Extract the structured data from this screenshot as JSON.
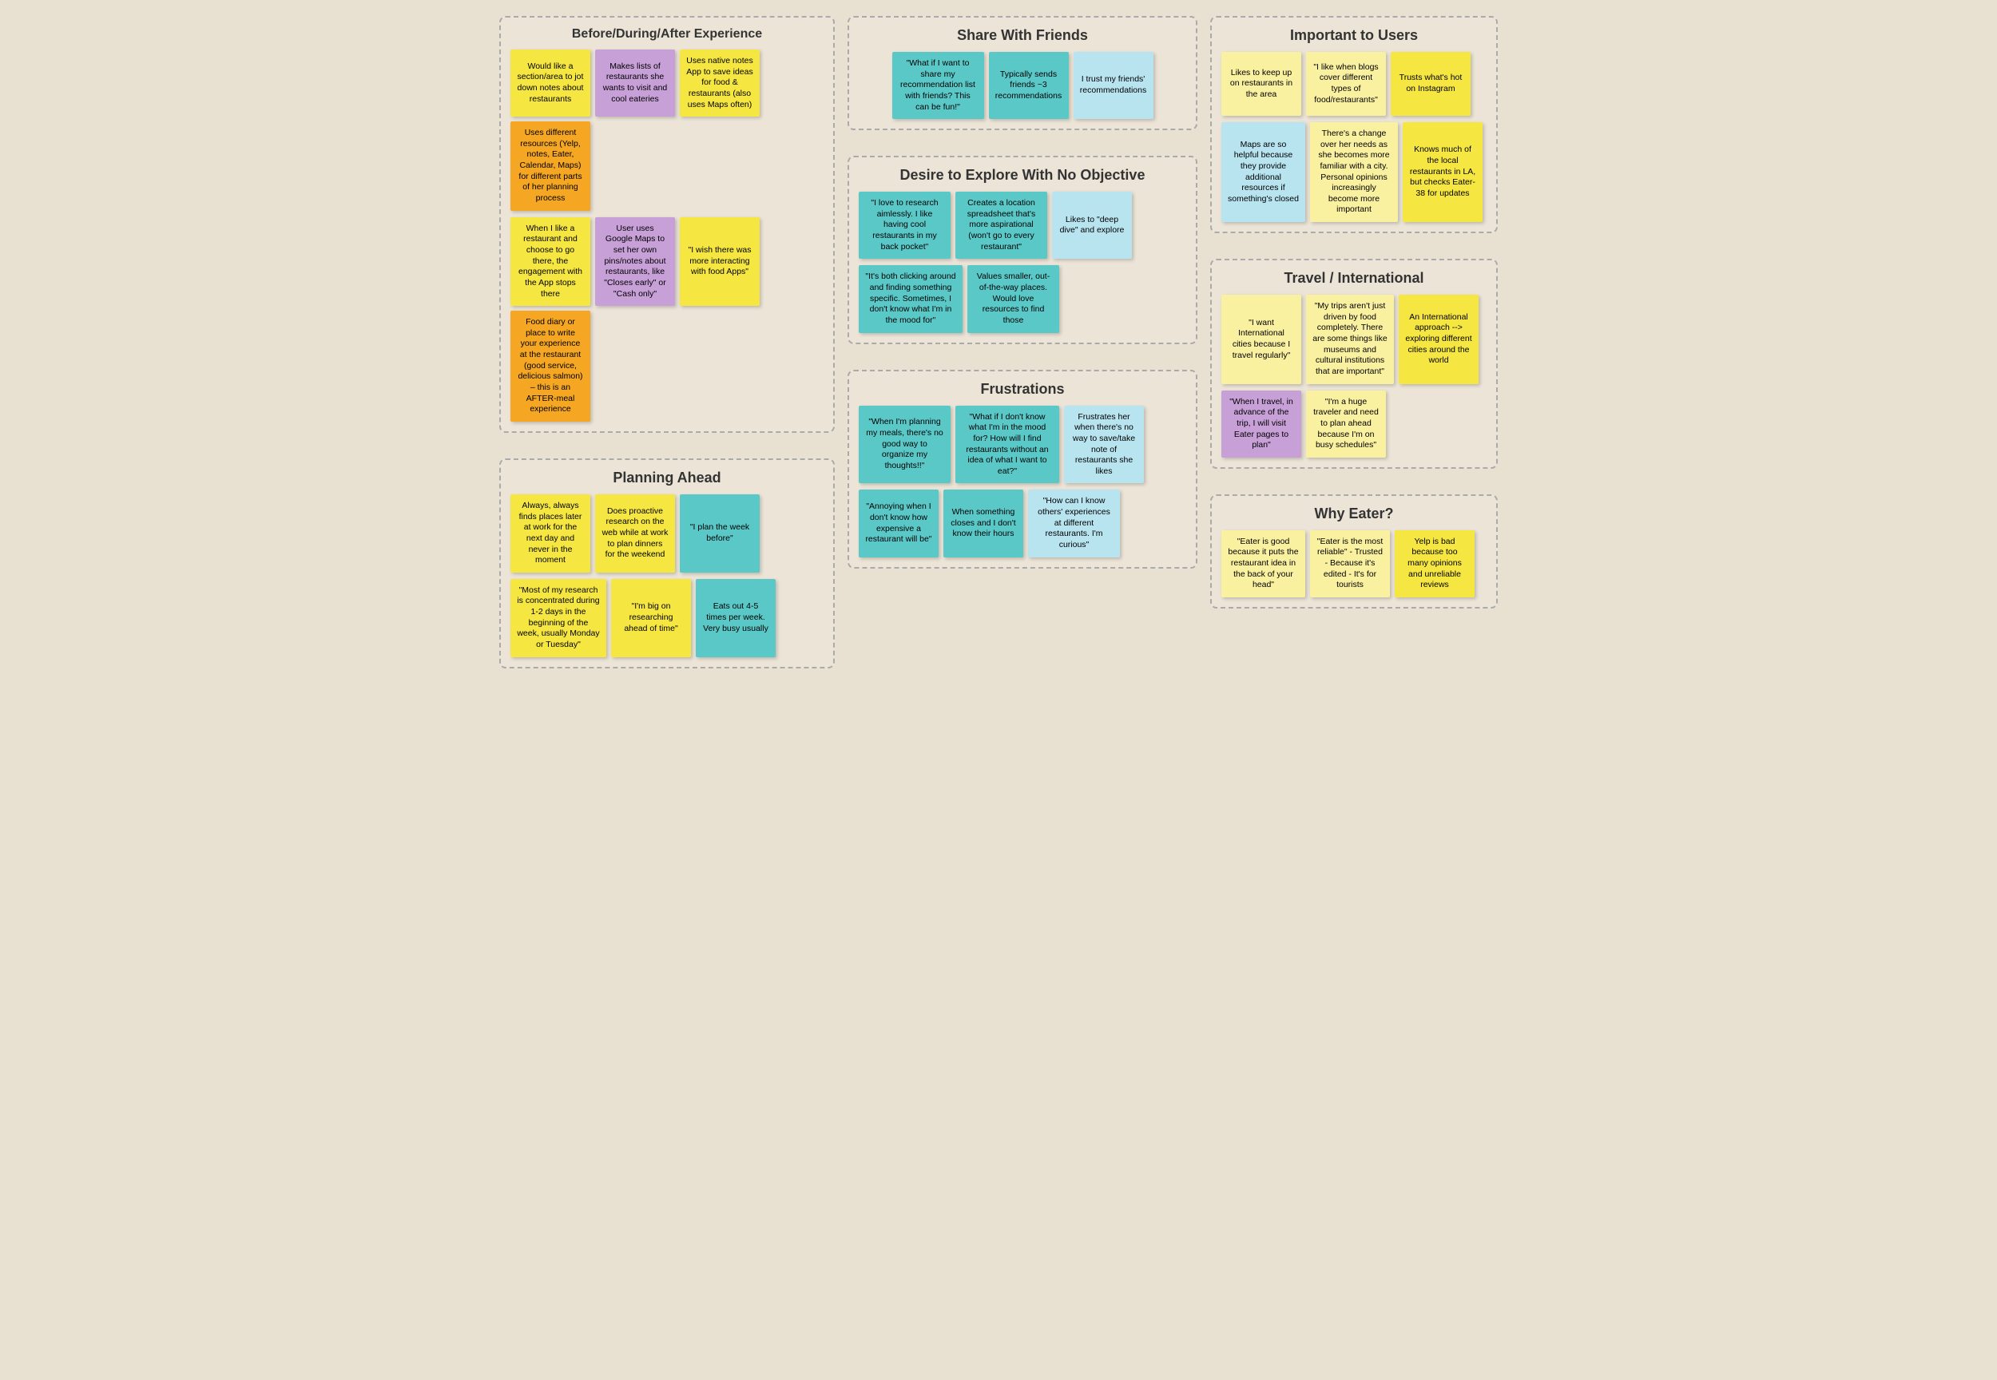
{
  "sections": {
    "before_during_after": {
      "title": "Before/During/After Experience",
      "stickies_row1": [
        {
          "text": "Would like a section/area to jot down notes about restaurants",
          "color": "yellow"
        },
        {
          "text": "Makes lists of restaurants she wants to visit and cool eateries",
          "color": "purple"
        },
        {
          "text": "Uses native notes App to save ideas for food & restaurants (also uses Maps often)",
          "color": "yellow"
        },
        {
          "text": "Uses different resources (Yelp, notes, Eater, Calendar, Maps) for different parts of her planning process",
          "color": "orange"
        }
      ],
      "stickies_row2": [
        {
          "text": "When I like a restaurant and choose to go there, the engagement with the App stops there",
          "color": "yellow"
        },
        {
          "text": "User uses Google Maps to set her own pins/notes about restaurants, like \"Closes early\" or \"Cash only\"",
          "color": "purple"
        },
        {
          "text": "\"I wish there was more interacting with food Apps\"",
          "color": "yellow"
        },
        {
          "text": "Food diary or place to write your experience at the restaurant (good service, delicious salmon) – this is an AFTER-meal experience",
          "color": "orange"
        }
      ]
    },
    "planning_ahead": {
      "title": "Planning Ahead",
      "stickies_row1": [
        {
          "text": "Always, always finds places later at work for the next day and never in the moment",
          "color": "yellow"
        },
        {
          "text": "Does proactive research on the web while at work to plan dinners for the weekend",
          "color": "yellow"
        },
        {
          "text": "\"I plan the week before\"",
          "color": "teal"
        }
      ],
      "stickies_row2": [
        {
          "text": "\"Most of my research is concentrated during 1-2 days in the beginning of the week, usually Monday or Tuesday\"",
          "color": "yellow"
        },
        {
          "text": "\"I'm big on researching ahead of time\"",
          "color": "yellow"
        },
        {
          "text": "Eats out 4-5 times per week. Very busy usually",
          "color": "teal"
        }
      ]
    },
    "share_with_friends": {
      "title": "Share With Friends",
      "stickies": [
        {
          "text": "\"What if I want to share my recommendation list with friends? This can be fun!\"",
          "color": "teal"
        },
        {
          "text": "Typically sends friends ~3 recommendations",
          "color": "teal"
        },
        {
          "text": "I trust my friends' recommendations",
          "color": "light-blue"
        }
      ]
    },
    "desire_to_explore": {
      "title": "Desire to Explore With No Objective",
      "stickies_row1": [
        {
          "text": "\"I love to research aimlessly. I like having cool restaurants in my back pocket\"",
          "color": "teal"
        },
        {
          "text": "Creates a location spreadsheet that's more aspirational (won't go to every restaurant\"",
          "color": "teal"
        },
        {
          "text": "Likes to \"deep dive\" and explore",
          "color": "light-blue"
        }
      ],
      "stickies_row2": [
        {
          "text": "\"It's both clicking around and finding something specific. Sometimes, I don't know what I'm in the mood for\"",
          "color": "teal"
        },
        {
          "text": "Values smaller, out-of-the-way places. Would love resources to find those",
          "color": "teal"
        }
      ]
    },
    "frustrations": {
      "title": "Frustrations",
      "stickies_row1": [
        {
          "text": "\"When I'm planning my meals, there's no good way to organize my thoughts!!\"",
          "color": "teal"
        },
        {
          "text": "\"What if I don't know what I'm in the mood for? How will I find restaurants without an idea of what I want to eat?\"",
          "color": "teal"
        },
        {
          "text": "Frustrates her when there's no way to save/take note of restaurants she likes",
          "color": "light-blue"
        }
      ],
      "stickies_row2": [
        {
          "text": "\"Annoying when I don't know how expensive a restaurant will be\"",
          "color": "teal"
        },
        {
          "text": "When something closes and I don't know their hours",
          "color": "teal"
        },
        {
          "text": "\"How can I know others' experiences at different restaurants. I'm curious\"",
          "color": "light-blue"
        }
      ]
    },
    "important_to_users": {
      "title": "Important to Users",
      "stickies_row1": [
        {
          "text": "Likes to keep up on restaurants in the area",
          "color": "light-yellow"
        },
        {
          "text": "\"I like when blogs cover different types of food/restaurants\"",
          "color": "light-yellow"
        },
        {
          "text": "Trusts what's hot on Instagram",
          "color": "yellow"
        }
      ],
      "stickies_row2": [
        {
          "text": "Maps are so helpful because they provide additional resources if something's closed",
          "color": "light-blue"
        },
        {
          "text": "There's a change over her needs as she becomes more familiar with a city. Personal opinions increasingly become more important",
          "color": "light-yellow"
        },
        {
          "text": "Knows much of the local restaurants in LA, but checks Eater-38 for updates",
          "color": "yellow"
        }
      ]
    },
    "travel_international": {
      "title": "Travel / International",
      "stickies_row1": [
        {
          "text": "\"I want International cities because I travel regularly\"",
          "color": "light-yellow"
        },
        {
          "text": "\"My trips aren't just driven by food completely. There are some things like museums and cultural institutions that are important\"",
          "color": "light-yellow"
        },
        {
          "text": "An International approach --> exploring different cities around the world",
          "color": "yellow"
        }
      ],
      "stickies_row2": [
        {
          "text": "\"When I travel, in advance of the trip, I will visit Eater pages to plan\"",
          "color": "purple"
        },
        {
          "text": "\"I'm a huge traveler and need to plan ahead because I'm on busy schedules\"",
          "color": "light-yellow"
        }
      ]
    },
    "why_eater": {
      "title": "Why Eater?",
      "stickies": [
        {
          "text": "\"Eater is good because it puts the restaurant idea in the back of your head\"",
          "color": "light-yellow"
        },
        {
          "text": "\"Eater is the most reliable\" - Trusted - Because it's edited - It's for tourists",
          "color": "light-yellow"
        },
        {
          "text": "Yelp is bad because too many opinions and unreliable reviews",
          "color": "yellow"
        }
      ]
    }
  }
}
